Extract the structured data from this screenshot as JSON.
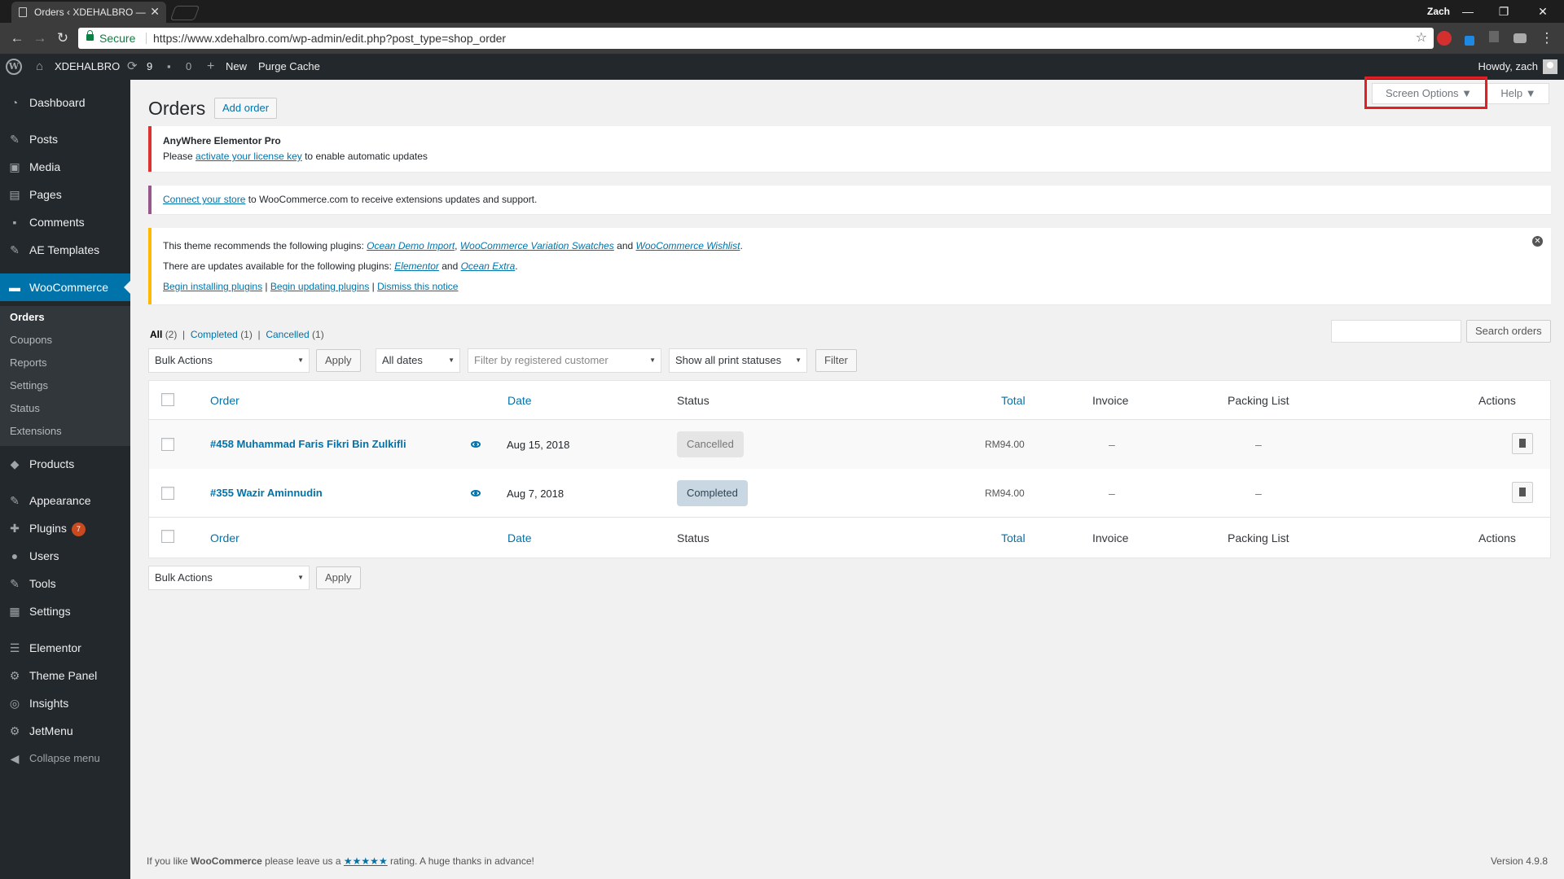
{
  "browser": {
    "tab_title": "Orders ‹ XDEHALBRO —",
    "user": "Zach",
    "secure_label": "Secure",
    "url": "https://www.xdehalbro.com/wp-admin/edit.php?post_type=shop_order"
  },
  "adminbar": {
    "site_name": "XDEHALBRO",
    "updates": "9",
    "comments": "0",
    "new_label": "New",
    "purge_label": "Purge Cache",
    "howdy": "Howdy, zach"
  },
  "sidebar": {
    "items": [
      {
        "label": "Dashboard"
      },
      {
        "label": "Posts"
      },
      {
        "label": "Media"
      },
      {
        "label": "Pages"
      },
      {
        "label": "Comments"
      },
      {
        "label": "AE Templates"
      },
      {
        "label": "WooCommerce"
      },
      {
        "label": "Products"
      },
      {
        "label": "Appearance"
      },
      {
        "label": "Plugins",
        "badge": "7"
      },
      {
        "label": "Users"
      },
      {
        "label": "Tools"
      },
      {
        "label": "Settings"
      },
      {
        "label": "Elementor"
      },
      {
        "label": "Theme Panel"
      },
      {
        "label": "Insights"
      },
      {
        "label": "JetMenu"
      },
      {
        "label": "Collapse menu"
      }
    ],
    "woo_submenu": [
      "Orders",
      "Coupons",
      "Reports",
      "Settings",
      "Status",
      "Extensions"
    ]
  },
  "header": {
    "screen_options": "Screen Options ▼",
    "help": "Help ▼",
    "title": "Orders",
    "add_order": "Add order"
  },
  "notices": {
    "n1_title": "AnyWhere Elementor Pro",
    "n1_pre": "Please ",
    "n1_link": "activate your license key",
    "n1_post": " to enable automatic updates",
    "n2_link": "Connect your store",
    "n2_post": " to WooCommerce.com to receive extensions updates and support.",
    "n3_line1_pre": "This theme recommends the following plugins: ",
    "n3_p1": "Ocean Demo Import",
    "n3_p2": "WooCommerce Variation Swatches",
    "n3_and": " and ",
    "n3_p3": "WooCommerce Wishlist",
    "n3_line2_pre": "There are updates available for the following plugins: ",
    "n3_u1": "Elementor",
    "n3_u2": "Ocean Extra",
    "n3_l1": "Begin installing plugins",
    "n3_l2": "Begin updating plugins",
    "n3_l3": "Dismiss this notice"
  },
  "filters": {
    "all": "All",
    "all_count": "(2)",
    "completed": "Completed",
    "completed_count": "(1)",
    "cancelled": "Cancelled",
    "cancelled_count": "(1)",
    "search_button": "Search orders",
    "bulk_actions": "Bulk Actions",
    "apply": "Apply",
    "all_dates": "All dates",
    "customer_placeholder": "Filter by registered customer",
    "print_statuses": "Show all print statuses",
    "filter": "Filter"
  },
  "table": {
    "columns": [
      "Order",
      "Date",
      "Status",
      "Total",
      "Invoice",
      "Packing List",
      "Actions"
    ],
    "rows": [
      {
        "order": "#458 Muhammad Faris Fikri Bin Zulkifli",
        "date": "Aug 15, 2018",
        "status": "Cancelled",
        "total": "RM94.00",
        "invoice": "–",
        "packing": "–"
      },
      {
        "order": "#355 Wazir Aminnudin",
        "date": "Aug 7, 2018",
        "status": "Completed",
        "total": "RM94.00",
        "invoice": "–",
        "packing": "–"
      }
    ]
  },
  "footer": {
    "pre": "If you like ",
    "brand": "WooCommerce",
    "mid": " please leave us a ",
    "stars": "★★★★★",
    "post": " rating. A huge thanks in advance!",
    "version": "Version 4.9.8"
  }
}
